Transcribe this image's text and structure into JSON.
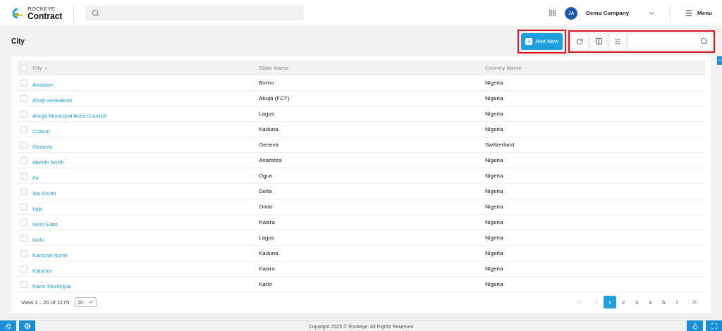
{
  "brand": {
    "top": "ROCKEYE",
    "bottom": "Contract"
  },
  "user": {
    "initials": "JA",
    "company": "Demo Company"
  },
  "menu": {
    "label": "Menu"
  },
  "page": {
    "title": "City"
  },
  "toolbar": {
    "add_label": "Add New"
  },
  "table": {
    "select_all_checked": false,
    "columns": [
      {
        "label": "City",
        "sorted": true
      },
      {
        "label": "State Name",
        "sorted": false
      },
      {
        "label": "Country Name",
        "sorted": false
      }
    ],
    "rows": [
      {
        "city": "Abadam",
        "state": "Borno",
        "country": "Nigeria",
        "checked": false
      },
      {
        "city": "Abaji venkatesh",
        "state": "Abuja (FCT)",
        "country": "Nigeria",
        "checked": false
      },
      {
        "city": "Abuja Municipal Area Council",
        "state": "Lagos",
        "country": "Nigeria",
        "checked": false
      },
      {
        "city": "Chikun",
        "state": "Kaduna",
        "country": "Nigeria",
        "checked": false
      },
      {
        "city": "Geneva",
        "state": "Geneva",
        "country": "Switzerland",
        "checked": false
      },
      {
        "city": "Idemili North",
        "state": "Anambra",
        "country": "Nigeria",
        "checked": false
      },
      {
        "city": "Ifo",
        "state": "Ogun",
        "country": "Nigeria",
        "checked": false
      },
      {
        "city": "Ika South",
        "state": "Delta",
        "country": "Nigeria",
        "checked": false
      },
      {
        "city": "Ilaje",
        "state": "Ondo",
        "country": "Nigeria",
        "checked": false
      },
      {
        "city": "Ilorin East",
        "state": "Kwara",
        "country": "Nigeria",
        "checked": false
      },
      {
        "city": "Isolo",
        "state": "Lagos",
        "country": "Nigeria",
        "checked": false
      },
      {
        "city": "Kaduna North",
        "state": "Kaduna",
        "country": "Nigeria",
        "checked": false
      },
      {
        "city": "Kaiama",
        "state": "Kwara",
        "country": "Nigeria",
        "checked": false
      },
      {
        "city": "Kano Municipal",
        "state": "Kano",
        "country": "Nigeria",
        "checked": false
      }
    ]
  },
  "pagination": {
    "summary": "View 1 - 20 of 1175",
    "page_size": "20",
    "pages": [
      {
        "label": "1",
        "selected": true
      },
      {
        "label": "2",
        "selected": false
      },
      {
        "label": "3",
        "selected": false
      },
      {
        "label": "4",
        "selected": false
      },
      {
        "label": "5",
        "selected": false
      }
    ]
  },
  "footer": {
    "copyright": "Copyright 2025 © Rockeye. All Rights Reserved"
  }
}
